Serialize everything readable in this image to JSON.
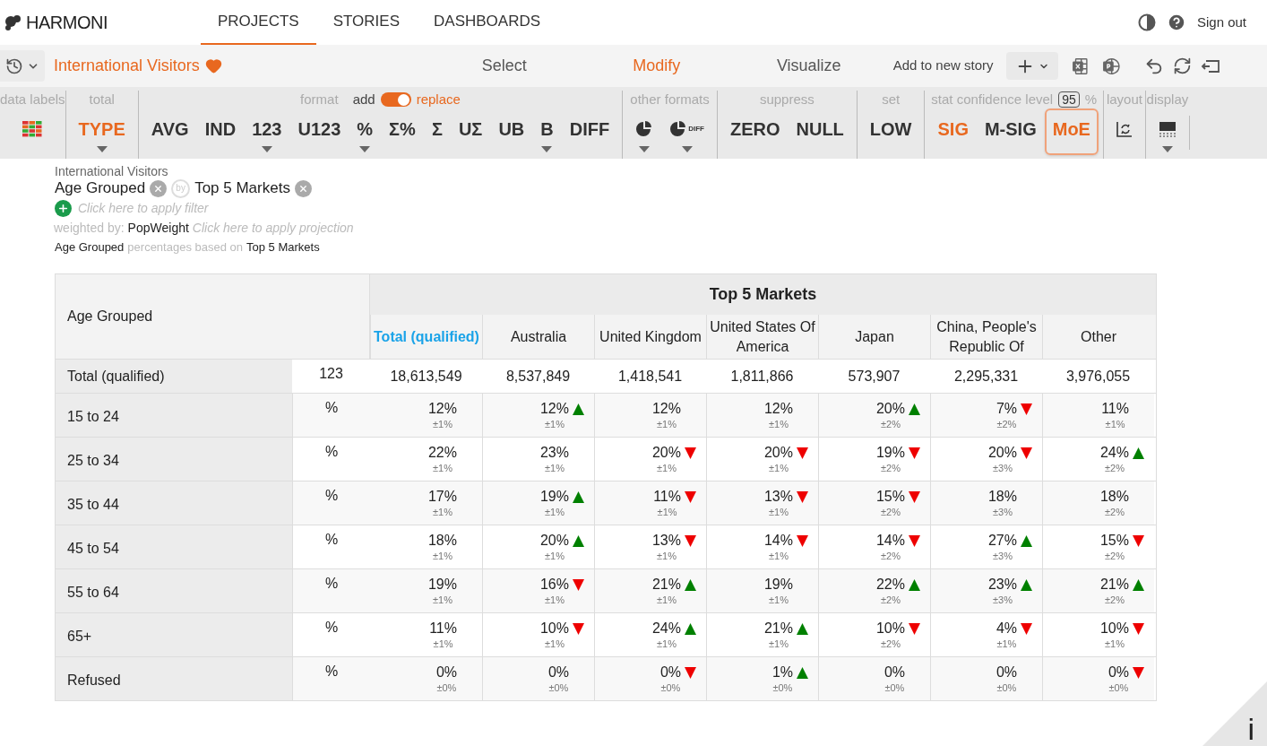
{
  "header": {
    "logo": "HARMONI",
    "tabs": [
      {
        "label": "PROJECTS",
        "selected": true
      },
      {
        "label": "STORIES",
        "selected": false
      },
      {
        "label": "DASHBOARDS",
        "selected": false
      }
    ],
    "sign_out": "Sign out"
  },
  "subbar": {
    "title": "International Visitors",
    "favorite": true,
    "steps": [
      {
        "label": "Select",
        "selected": false
      },
      {
        "label": "Modify",
        "selected": true
      },
      {
        "label": "Visualize",
        "selected": false
      }
    ],
    "add_story": "Add to new story"
  },
  "toolbar": {
    "groups": [
      {
        "label": "data labels",
        "buttons": [
          {
            "kind": "heatmap",
            "selected": false,
            "dropdown": false,
            "focused": false
          }
        ]
      },
      {
        "label": "total",
        "buttons": [
          {
            "kind": "text",
            "label": "TYPE",
            "selected": true,
            "dropdown": true,
            "focused": false
          }
        ]
      },
      {
        "label": "format",
        "toggle": {
          "left": "add",
          "right": "replace",
          "on": true
        },
        "buttons": [
          {
            "kind": "text",
            "label": "AVG",
            "selected": false,
            "dropdown": false,
            "focused": false
          },
          {
            "kind": "text",
            "label": "IND",
            "selected": false,
            "dropdown": false,
            "focused": false
          },
          {
            "kind": "text",
            "label": "123",
            "selected": false,
            "dropdown": true,
            "focused": false
          },
          {
            "kind": "text",
            "label": "U123",
            "selected": false,
            "dropdown": false,
            "focused": false
          },
          {
            "kind": "text",
            "label": "%",
            "selected": false,
            "dropdown": true,
            "focused": false
          },
          {
            "kind": "text",
            "label": "Σ%",
            "selected": false,
            "dropdown": false,
            "focused": false
          },
          {
            "kind": "text",
            "label": "Σ",
            "selected": false,
            "dropdown": false,
            "focused": false
          },
          {
            "kind": "text",
            "label": "UΣ",
            "selected": false,
            "dropdown": false,
            "focused": false
          },
          {
            "kind": "text",
            "label": "UB",
            "selected": false,
            "dropdown": false,
            "focused": false
          },
          {
            "kind": "text",
            "label": "B",
            "selected": false,
            "dropdown": true,
            "focused": false
          },
          {
            "kind": "text",
            "label": "DIFF",
            "selected": false,
            "dropdown": false,
            "focused": false
          }
        ]
      },
      {
        "label": "other formats",
        "buttons": [
          {
            "kind": "pie",
            "selected": false,
            "dropdown": true,
            "focused": false
          },
          {
            "kind": "pie-tag",
            "label": "DIFF",
            "selected": false,
            "dropdown": true,
            "focused": false
          }
        ]
      },
      {
        "label": "suppress",
        "buttons": [
          {
            "kind": "text",
            "label": "ZERO",
            "selected": false,
            "dropdown": false,
            "focused": false
          },
          {
            "kind": "text",
            "label": "NULL",
            "selected": false,
            "dropdown": false,
            "focused": false
          }
        ]
      },
      {
        "label": "set",
        "buttons": [
          {
            "kind": "text",
            "label": "LOW",
            "selected": false,
            "dropdown": false,
            "focused": false
          }
        ]
      },
      {
        "label": "stat confidence level",
        "confidence": "95",
        "unit": "%",
        "buttons": [
          {
            "kind": "text",
            "label": "SIG",
            "selected": true,
            "dropdown": false,
            "focused": false
          },
          {
            "kind": "text",
            "label": "M-SIG",
            "selected": false,
            "dropdown": false,
            "focused": false
          },
          {
            "kind": "text",
            "label": "MoE",
            "selected": true,
            "dropdown": false,
            "focused": true
          }
        ]
      },
      {
        "label": "layout",
        "buttons": [
          {
            "kind": "layout",
            "selected": false,
            "dropdown": false,
            "focused": false
          }
        ]
      },
      {
        "label": "display",
        "buttons": [
          {
            "kind": "display",
            "selected": false,
            "dropdown": true,
            "focused": false
          }
        ]
      }
    ]
  },
  "query": {
    "dataset": "International Visitors",
    "rows_variable": "Age Grouped",
    "by": "by",
    "columns_variable": "Top 5 Markets",
    "filter_placeholder": "Click here to apply filter",
    "weight_label": "weighted by:",
    "weight": "PopWeight",
    "projection_placeholder": "Click here to apply projection",
    "base_row": "Age Grouped",
    "base_text": "percentages based on",
    "base_column": "Top 5 Markets"
  },
  "table": {
    "row_header": "Age Grouped",
    "banner": "Top 5 Markets",
    "columns": [
      {
        "label": "Total (qualified)",
        "total": true
      },
      {
        "label": "Australia",
        "total": false
      },
      {
        "label": "United Kingdom",
        "total": false
      },
      {
        "label": "United States Of America",
        "total": false
      },
      {
        "label": "Japan",
        "total": false
      },
      {
        "label": "China, People's Republic Of",
        "total": false
      },
      {
        "label": "Other",
        "total": false
      }
    ],
    "total_row": {
      "label": "Total (qualified)",
      "unit": "123",
      "values": [
        "18,613,549",
        "8,537,849",
        "1,418,541",
        "1,811,866",
        "573,907",
        "2,295,331",
        "3,976,055"
      ]
    },
    "rows": [
      {
        "label": "15 to 24",
        "unit": "%",
        "cells": [
          {
            "value": "12%",
            "moe": "±1%",
            "kind": "plain"
          },
          {
            "value": "12%",
            "moe": "±1%",
            "kind": "up"
          },
          {
            "value": "12%",
            "moe": "±1%",
            "kind": "plain"
          },
          {
            "value": "12%",
            "moe": "±1%",
            "kind": "plain"
          },
          {
            "value": "20%",
            "moe": "±2%",
            "kind": "up"
          },
          {
            "value": "7%",
            "moe": "±2%",
            "kind": "down"
          },
          {
            "value": "11%",
            "moe": "±1%",
            "kind": "plain"
          }
        ]
      },
      {
        "label": "25 to 34",
        "unit": "%",
        "cells": [
          {
            "value": "22%",
            "moe": "±1%",
            "kind": "plain"
          },
          {
            "value": "23%",
            "moe": "±1%",
            "kind": "plain"
          },
          {
            "value": "20%",
            "moe": "±1%",
            "kind": "down"
          },
          {
            "value": "20%",
            "moe": "±1%",
            "kind": "down"
          },
          {
            "value": "19%",
            "moe": "±2%",
            "kind": "down"
          },
          {
            "value": "20%",
            "moe": "±3%",
            "kind": "down"
          },
          {
            "value": "24%",
            "moe": "±2%",
            "kind": "up"
          }
        ]
      },
      {
        "label": "35 to 44",
        "unit": "%",
        "cells": [
          {
            "value": "17%",
            "moe": "±1%",
            "kind": "plain"
          },
          {
            "value": "19%",
            "moe": "±1%",
            "kind": "up"
          },
          {
            "value": "11%",
            "moe": "±1%",
            "kind": "down"
          },
          {
            "value": "13%",
            "moe": "±1%",
            "kind": "down"
          },
          {
            "value": "15%",
            "moe": "±2%",
            "kind": "down"
          },
          {
            "value": "18%",
            "moe": "±3%",
            "kind": "plain"
          },
          {
            "value": "18%",
            "moe": "±2%",
            "kind": "plain"
          }
        ]
      },
      {
        "label": "45 to 54",
        "unit": "%",
        "cells": [
          {
            "value": "18%",
            "moe": "±1%",
            "kind": "plain"
          },
          {
            "value": "20%",
            "moe": "±1%",
            "kind": "up"
          },
          {
            "value": "13%",
            "moe": "±1%",
            "kind": "down"
          },
          {
            "value": "14%",
            "moe": "±1%",
            "kind": "down"
          },
          {
            "value": "14%",
            "moe": "±2%",
            "kind": "down"
          },
          {
            "value": "27%",
            "moe": "±3%",
            "kind": "up"
          },
          {
            "value": "15%",
            "moe": "±2%",
            "kind": "down"
          }
        ]
      },
      {
        "label": "55 to 64",
        "unit": "%",
        "cells": [
          {
            "value": "19%",
            "moe": "±1%",
            "kind": "plain"
          },
          {
            "value": "16%",
            "moe": "±1%",
            "kind": "down"
          },
          {
            "value": "21%",
            "moe": "±1%",
            "kind": "up"
          },
          {
            "value": "19%",
            "moe": "±1%",
            "kind": "plain"
          },
          {
            "value": "22%",
            "moe": "±2%",
            "kind": "up"
          },
          {
            "value": "23%",
            "moe": "±3%",
            "kind": "up"
          },
          {
            "value": "21%",
            "moe": "±2%",
            "kind": "up"
          }
        ]
      },
      {
        "label": "65+",
        "unit": "%",
        "cells": [
          {
            "value": "11%",
            "moe": "±1%",
            "kind": "plain"
          },
          {
            "value": "10%",
            "moe": "±1%",
            "kind": "down"
          },
          {
            "value": "24%",
            "moe": "±1%",
            "kind": "up"
          },
          {
            "value": "21%",
            "moe": "±1%",
            "kind": "up"
          },
          {
            "value": "10%",
            "moe": "±2%",
            "kind": "down"
          },
          {
            "value": "4%",
            "moe": "±1%",
            "kind": "down"
          },
          {
            "value": "10%",
            "moe": "±1%",
            "kind": "down"
          }
        ]
      },
      {
        "label": "Refused",
        "unit": "%",
        "cells": [
          {
            "value": "0%",
            "moe": "±0%",
            "kind": "plain"
          },
          {
            "value": "0%",
            "moe": "±0%",
            "kind": "plain"
          },
          {
            "value": "0%",
            "moe": "±0%",
            "kind": "down"
          },
          {
            "value": "1%",
            "moe": "±0%",
            "kind": "up"
          },
          {
            "value": "0%",
            "moe": "±0%",
            "kind": "plain"
          },
          {
            "value": "0%",
            "moe": "±0%",
            "kind": "plain"
          },
          {
            "value": "0%",
            "moe": "±0%",
            "kind": "down"
          }
        ]
      }
    ]
  },
  "info_corner": "i"
}
